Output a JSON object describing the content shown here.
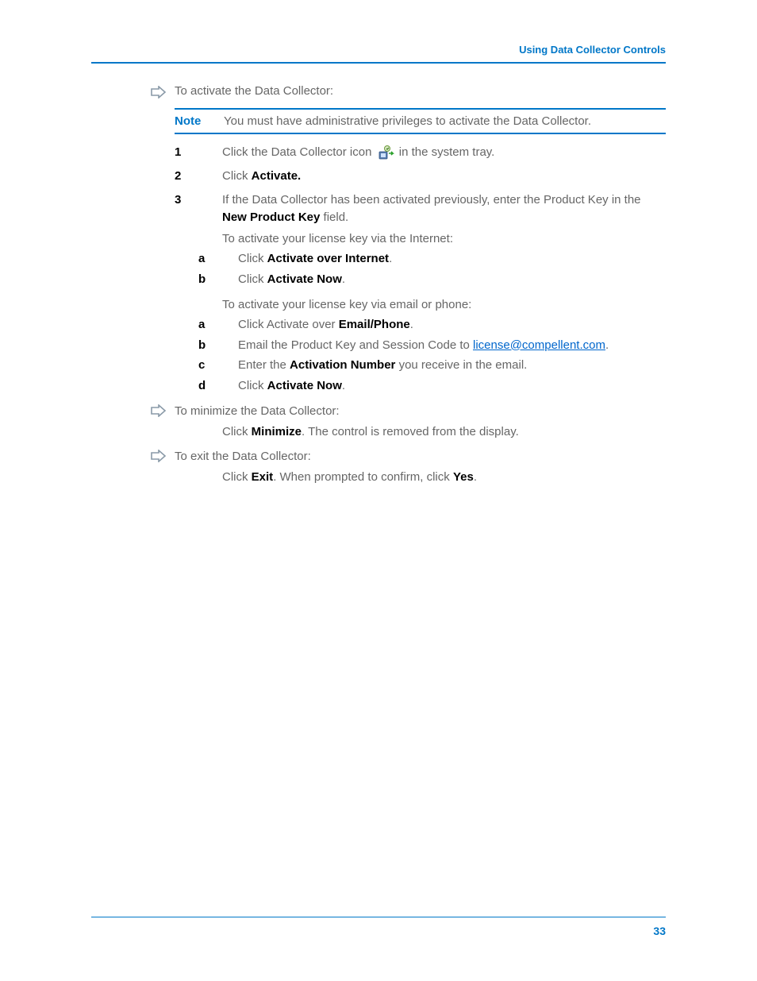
{
  "header": {
    "section": "Using Data Collector Controls"
  },
  "footer": {
    "page": "33"
  },
  "sections": {
    "activate": {
      "intro": "To activate the Data Collector:",
      "note_label": "Note",
      "note_text": "You must have administrative privileges to activate the Data Collector.",
      "step1_a": "Click the Data Collector icon ",
      "step1_b": " in the system tray.",
      "step2_a": "Click ",
      "step2_b": "Activate.",
      "step3_a": "If the Data Collector has been activated previously, enter the Product Key in the ",
      "step3_b": "New Product Key",
      "step3_c": " field.",
      "sub_intro1": "To activate your license key via the Internet:",
      "s1a_a": "Click ",
      "s1a_b": "Activate over Internet",
      "s1a_c": ".",
      "s1b_a": "Click ",
      "s1b_b": "Activate Now",
      "s1b_c": ".",
      "sub_intro2": "To activate your license key via email or phone:",
      "s2a_a": "Click Activate over ",
      "s2a_b": "Email/Phone",
      "s2a_c": ".",
      "s2b_a": "Email the Product Key and Session Code to ",
      "s2b_link": "license@compellent.com",
      "s2b_c": ".",
      "s2c_a": "Enter the ",
      "s2c_b": "Activation Number",
      "s2c_c": " you receive in the email.",
      "s2d_a": "Click ",
      "s2d_b": "Activate Now",
      "s2d_c": "."
    },
    "minimize": {
      "intro": "To minimize the Data Collector:",
      "body_a": "Click ",
      "body_b": "Minimize",
      "body_c": ". The control is removed from the display."
    },
    "exit": {
      "intro": "To exit the Data Collector:",
      "body_a": "Click ",
      "body_b": "Exit",
      "body_c": ". When prompted to confirm, click ",
      "body_d": "Yes",
      "body_e": "."
    }
  }
}
